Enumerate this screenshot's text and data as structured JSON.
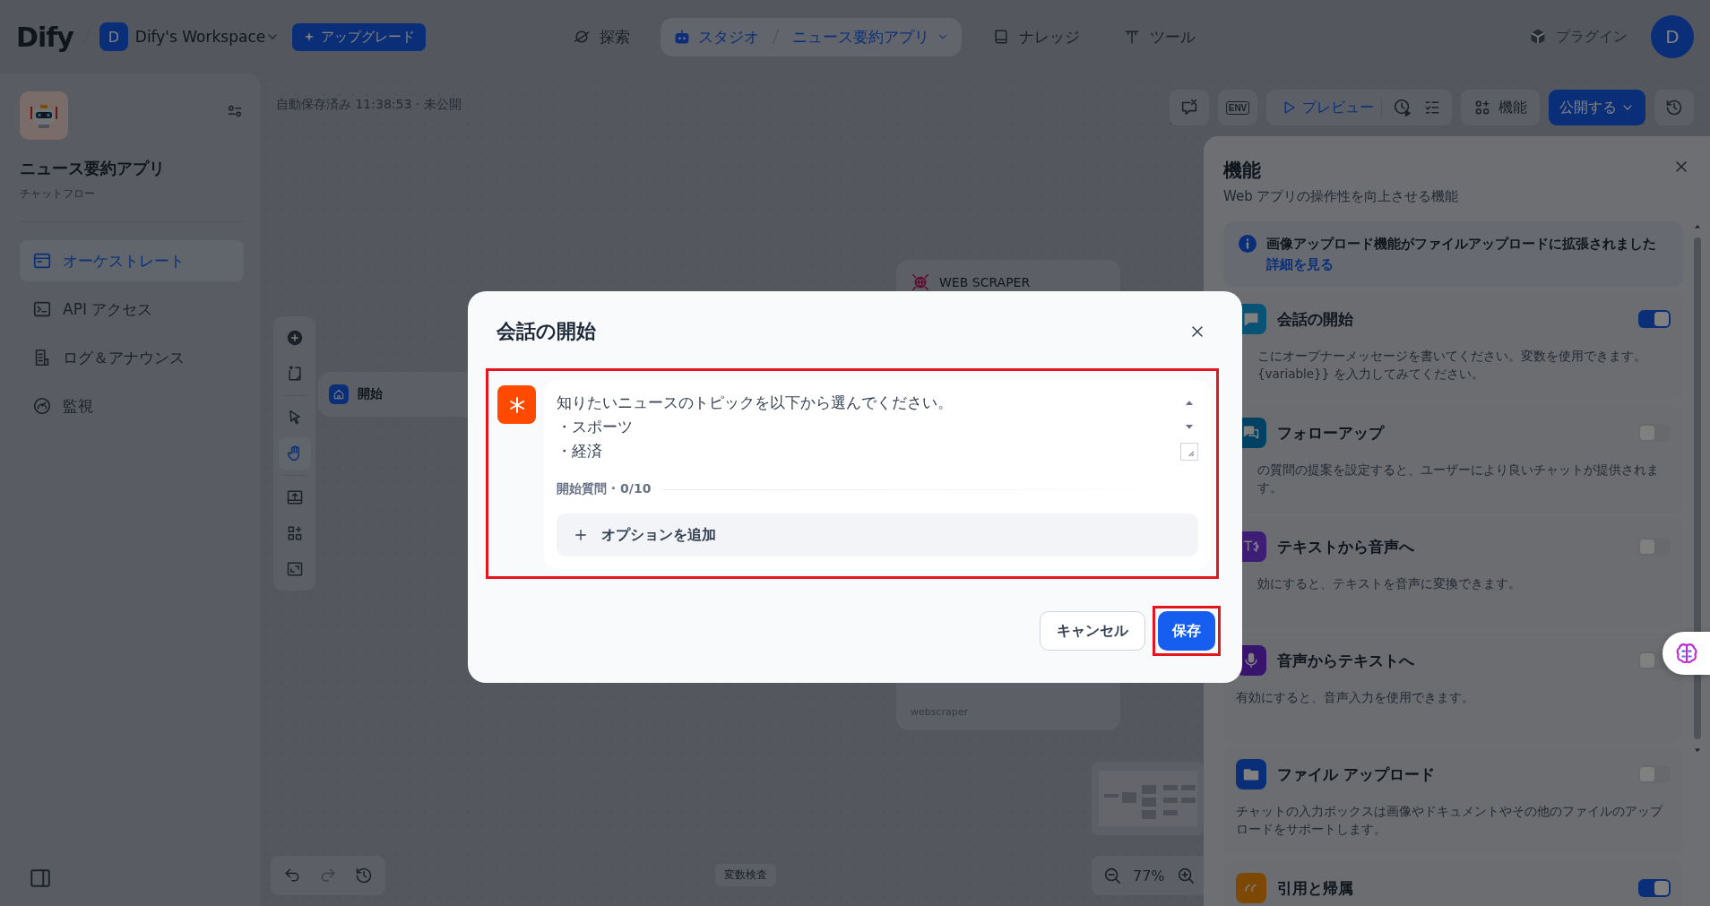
{
  "header": {
    "logo": "Dify",
    "workspace_initial": "D",
    "workspace": "Dify's Workspace",
    "upgrade": "アップグレード",
    "nav": [
      {
        "label": "探索",
        "selected": false
      },
      {
        "label": "スタジオ",
        "selected": true,
        "app": "ニュース要約アプリ"
      },
      {
        "label": "ナレッジ",
        "selected": false
      },
      {
        "label": "ツール",
        "selected": false
      }
    ],
    "plugins": "プラグイン",
    "user_initial": "D"
  },
  "sidebar": {
    "app_name": "ニュース要約アプリ",
    "app_type": "チャットフロー",
    "items": [
      {
        "label": "オーケストレート",
        "selected": true
      },
      {
        "label": "API アクセス",
        "selected": false
      },
      {
        "label": "ログ＆アナウンス",
        "selected": false
      },
      {
        "label": "監視",
        "selected": false
      }
    ]
  },
  "canvas": {
    "save_status": "自動保存済み 11:38:53 · 未公開",
    "preview": "プレビュー",
    "features": "機能",
    "publish": "公開する",
    "tools": [
      {
        "selected": false
      },
      {
        "selected": false
      },
      {
        "selected": false
      },
      {
        "selected": true
      },
      {
        "selected": false
      },
      {
        "selected": false
      },
      {
        "selected": false
      }
    ],
    "nodes": [
      {
        "kind": "start",
        "title": "開始"
      },
      {
        "kind": "tool",
        "title": "WEB SCRAPER"
      },
      {
        "kind": "tool",
        "footer": "webscraper"
      }
    ],
    "env_label": "ENV",
    "zoom": "77%",
    "variable_inspect": "変数検査"
  },
  "features_panel": {
    "title": "機能",
    "subtitle": "Web アプリの操作性を向上させる機能",
    "notice": {
      "text": "画像アップロード機能がファイルアップロードに拡張されました",
      "link": "詳細を見る"
    },
    "features": [
      {
        "title": "会話の開始",
        "description": "こにオープナーメッセージを書いてください。変数を使用できます。{variable}} を入力してみてください。",
        "on": true
      },
      {
        "title": "フォローアップ",
        "description": "の質問の提案を設定すると、ユーザーにより良いチャットが提供されます。",
        "on": false
      },
      {
        "title": "テキストから音声へ",
        "description": "効にすると、テキストを音声に変換できます。",
        "on": false
      },
      {
        "title": "音声からテキストへ",
        "description": "有効にすると、音声入力を使用できます。",
        "on": false
      },
      {
        "title": "ファイル アップロード",
        "description": "チャットの入力ボックスは画像やドキュメントやその他のファイルのアップロードをサポートします。",
        "on": false
      },
      {
        "title": "引用と帰属",
        "on": true
      }
    ]
  },
  "dialog": {
    "title": "会話の開始",
    "opener_lines": [
      "知りたいニュースのトピックを以下から選んでください。",
      "・スポーツ",
      "・経済"
    ],
    "questions_label": "開始質問 · 0/10",
    "add_option": "オプションを追加",
    "cancel": "キャンセル",
    "save": "保存",
    "highlight_opener": true,
    "highlight_save": true
  }
}
